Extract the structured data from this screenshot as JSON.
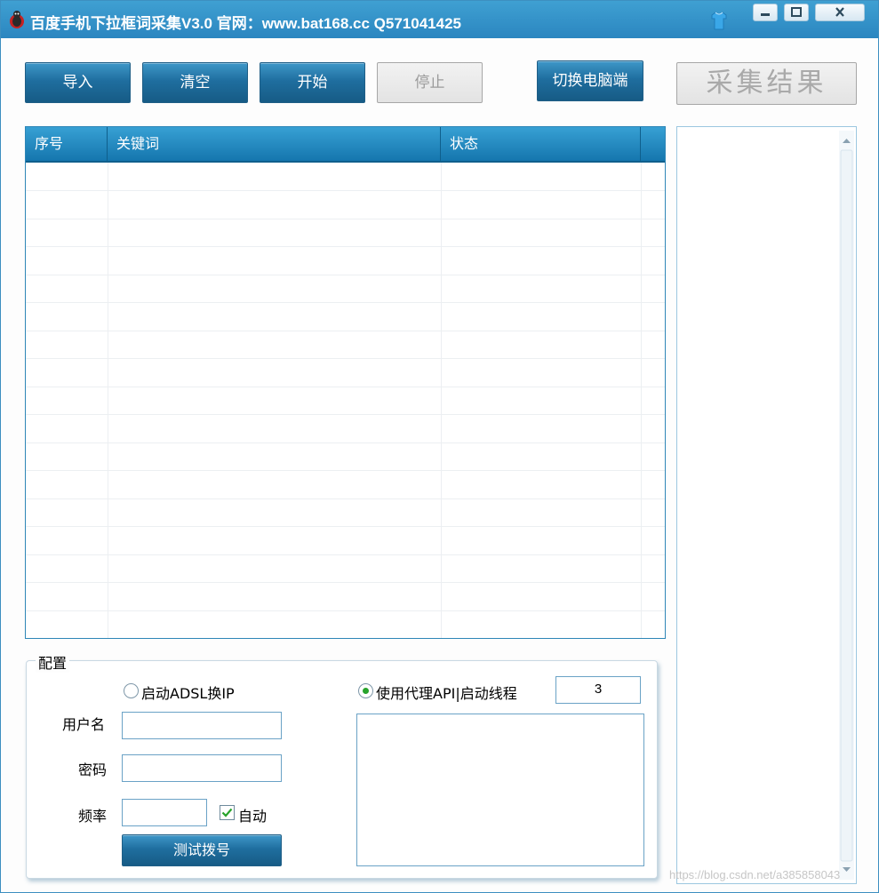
{
  "window": {
    "title": "百度手机下拉框词采集V3.0  官网：www.bat168.cc   Q571041425",
    "icon": "app-bug-icon",
    "controls": [
      "minimize",
      "maximize",
      "close"
    ]
  },
  "toolbar": {
    "import_label": "导入",
    "clear_label": "清空",
    "start_label": "开始",
    "stop_label": "停止",
    "switch_label": "切换电脑端",
    "results_label": "采集结果"
  },
  "grid": {
    "columns": [
      "序号",
      "关键词",
      "状态"
    ],
    "rows": []
  },
  "config": {
    "title": "配置",
    "adsl_label": "启动ADSL换IP",
    "adsl_selected": false,
    "username_label": "用户名",
    "username_value": "",
    "password_label": "密码",
    "password_value": "",
    "frequency_label": "频率",
    "frequency_value": "",
    "auto_label": "自动",
    "auto_checked": true,
    "test_dial_label": "测试拨号",
    "proxy_label": "使用代理API|启动线程",
    "proxy_selected": true,
    "threads_value": "3",
    "proxy_api_text": ""
  },
  "watermark": "https://blog.csdn.net/a385858043",
  "colors": {
    "titlebar": "#2b86c0",
    "button": "#1f6e9f",
    "grid_header": "#1576ae",
    "radio_dot": "#27a32b",
    "check_mark": "#27a32b"
  }
}
